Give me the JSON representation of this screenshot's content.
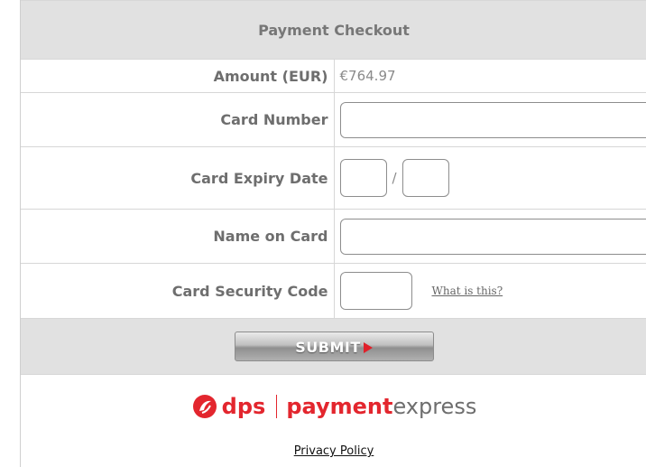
{
  "header": {
    "title": "Payment Checkout"
  },
  "fields": {
    "amount": {
      "label": "Amount (EUR)",
      "value": "€764.97"
    },
    "card_number": {
      "label": "Card Number",
      "value": "",
      "placeholder": ""
    },
    "expiry": {
      "label": "Card Expiry Date",
      "month": "",
      "year": "",
      "separator": "/"
    },
    "name": {
      "label": "Name on Card",
      "value": "",
      "placeholder": ""
    },
    "security_code": {
      "label": "Card Security Code",
      "value": "",
      "help_link": "What is this?"
    }
  },
  "submit": {
    "label": "SUBMIT"
  },
  "footer": {
    "logo": {
      "part1": "dps",
      "part2": "payment",
      "part3": "express"
    },
    "privacy_link": "Privacy Policy"
  },
  "colors": {
    "brand_red": "#e3262e",
    "header_bg": "#e1e1e1",
    "label_text": "#6e6e6e"
  },
  "icons": {
    "logo_mark": "dps-swirl-icon",
    "submit_arrow": "play-arrow-icon"
  }
}
